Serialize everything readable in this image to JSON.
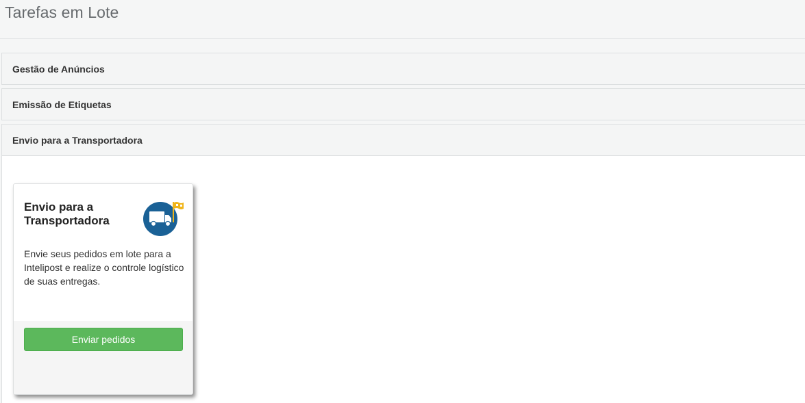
{
  "page": {
    "title": "Tarefas em Lote"
  },
  "accordion": {
    "panels": [
      {
        "label": "Gestão de Anúncios",
        "expanded": false
      },
      {
        "label": "Emissão de Etiquetas",
        "expanded": false
      },
      {
        "label": "Envio para a Transportadora",
        "expanded": true
      }
    ]
  },
  "card": {
    "title": "Envio para a Transportadora",
    "description": "Envie seus pedidos em lote para a Intelipost e realize o controle logístico de suas entregas.",
    "icon": "delivery-truck-flag-icon",
    "button_label": "Enviar pedidos"
  },
  "colors": {
    "icon_circle": "#1a6196",
    "flag": "#f0b51a",
    "button": "#5cb85c"
  }
}
